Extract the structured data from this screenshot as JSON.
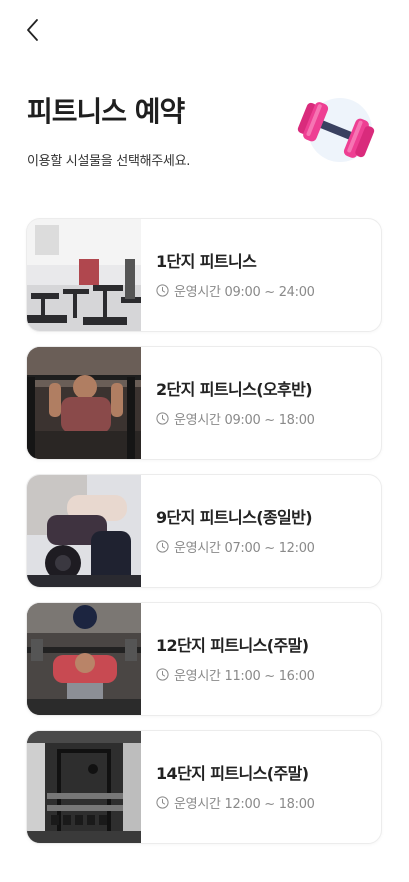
{
  "header": {
    "title": "피트니스 예약",
    "subtitle": "이용할 시설물을 선택해주세요."
  },
  "facilities": [
    {
      "name": "1단지 피트니스",
      "hours": "운영시간 09:00 ~ 24:00"
    },
    {
      "name": "2단지 피트니스(오후반)",
      "hours": "운영시간 09:00 ~ 18:00"
    },
    {
      "name": "9단지 피트니스(종일반)",
      "hours": "운영시간 07:00 ~ 12:00"
    },
    {
      "name": "12단지 피트니스(주말)",
      "hours": "운영시간 11:00 ~ 16:00"
    },
    {
      "name": "14단지 피트니스(주말)",
      "hours": "운영시간 12:00 ~ 18:00"
    }
  ],
  "colors": {
    "dumbbell": "#ee3f93",
    "dumbbell_handle": "#3a4160",
    "muted_text": "#8a8a8a"
  }
}
